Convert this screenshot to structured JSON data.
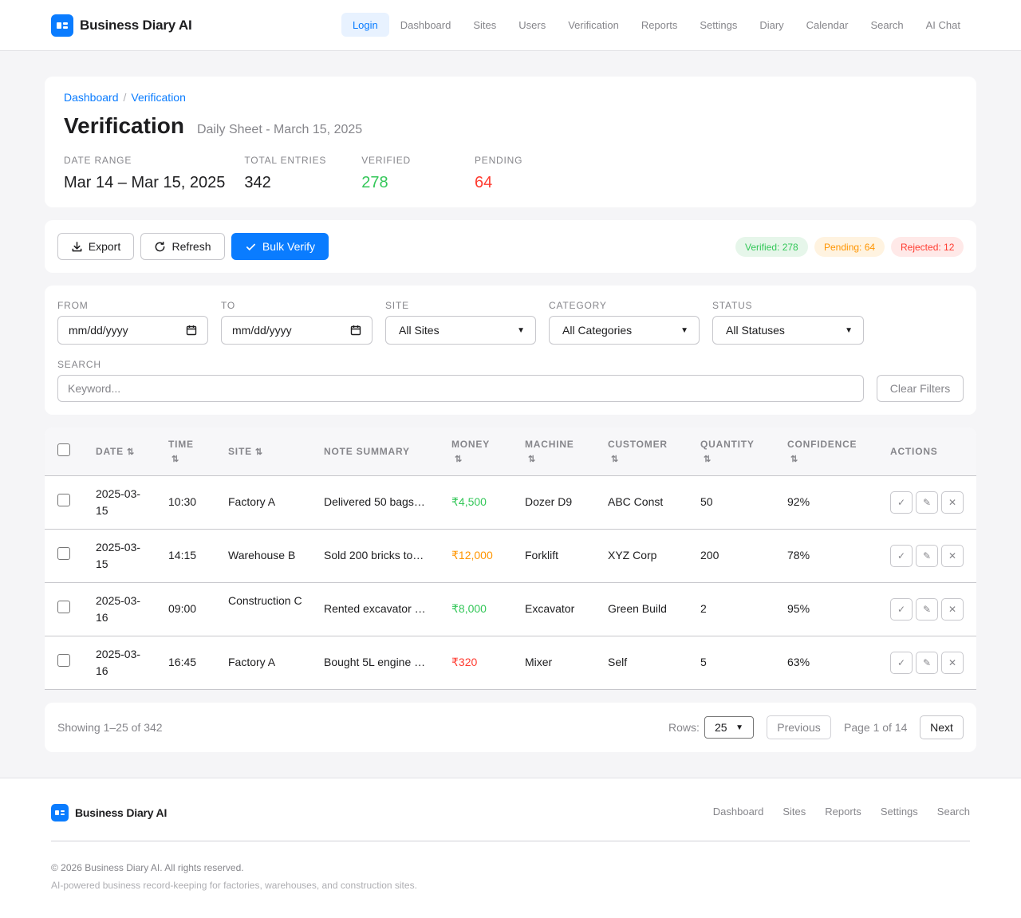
{
  "app": {
    "name": "Business Diary AI"
  },
  "nav": [
    "Login",
    "Dashboard",
    "Sites",
    "Users",
    "Verification",
    "Reports",
    "Settings",
    "Diary",
    "Calendar",
    "Search",
    "AI Chat"
  ],
  "breadcrumb": [
    "Dashboard",
    "Verification"
  ],
  "page": {
    "title": "Verification",
    "subtitle": "Daily Sheet - March 15, 2025"
  },
  "stats": [
    {
      "label": "DATE RANGE",
      "value": "Mar 14 – Mar 15, 2025"
    },
    {
      "label": "TOTAL ENTRIES",
      "value": "342"
    },
    {
      "label": "VERIFIED",
      "value": "278"
    },
    {
      "label": "PENDING",
      "value": "64"
    }
  ],
  "toolbar": {
    "export": "Export",
    "refresh": "Refresh",
    "bulk_verify": "Bulk Verify"
  },
  "status_pills": {
    "verified": "Verified: 278",
    "pending": "Pending: 64",
    "rejected": "Rejected: 12"
  },
  "filters": {
    "from_label": "FROM",
    "from_value": "mm/dd/yyyy",
    "to_label": "TO",
    "to_value": "mm/dd/yyyy",
    "site_label": "SITE",
    "site_value": "All Sites",
    "category_label": "CATEGORY",
    "category_value": "All Categories",
    "status_label": "STATUS",
    "status_value": "All Statuses",
    "search_label": "SEARCH",
    "search_placeholder": "Keyword...",
    "clear": "Clear Filters"
  },
  "table": {
    "headers": {
      "date": "DATE",
      "time": "TIME",
      "site": "SITE",
      "note": "NOTE SUMMARY",
      "money": "MONEY",
      "machine": "MACHINE",
      "customer": "CUSTOMER",
      "quantity": "QUANTITY",
      "confidence": "CONFIDENCE",
      "actions": "ACTIONS"
    },
    "sort_glyph": "⇅",
    "rows": [
      {
        "date": "2025-03-15",
        "time": "10:30",
        "site": "Factory A",
        "note": "Delivered 50 bags…",
        "money": "₹4,500",
        "machine": "Dozer D9",
        "customer": "ABC Const",
        "quantity": "50",
        "confidence": "92%"
      },
      {
        "date": "2025-03-15",
        "time": "14:15",
        "site": "Warehouse B",
        "note": "Sold 200 bricks to…",
        "money": "₹12,000",
        "machine": "Forklift",
        "customer": "XYZ Corp",
        "quantity": "200",
        "confidence": "78%"
      },
      {
        "date": "2025-03-16",
        "time": "09:00",
        "site": "Construction C",
        "note": "Rented excavator …",
        "money": "₹8,000",
        "machine": "Excavator",
        "customer": "Green Build",
        "quantity": "2",
        "confidence": "95%"
      },
      {
        "date": "2025-03-16",
        "time": "16:45",
        "site": "Factory A",
        "note": "Bought 5L engine …",
        "money": "₹320",
        "machine": "Mixer",
        "customer": "Self",
        "quantity": "5",
        "confidence": "63%"
      }
    ]
  },
  "pagination": {
    "showing": "Showing 1–25 of 342",
    "rows_label": "Rows:",
    "rows_value": "25",
    "previous": "Previous",
    "page_info": "Page 1 of 14",
    "next": "Next"
  },
  "footer": {
    "links": [
      "Dashboard",
      "Sites",
      "Reports",
      "Settings",
      "Search"
    ],
    "copyright": "© 2026 Business Diary AI. All rights reserved.",
    "tagline": "AI-powered business record-keeping for factories, warehouses, and construction sites."
  },
  "colors": {
    "accent": "#0a7cff",
    "green": "#34c759",
    "orange": "#ff9500",
    "red": "#ff3b30"
  }
}
